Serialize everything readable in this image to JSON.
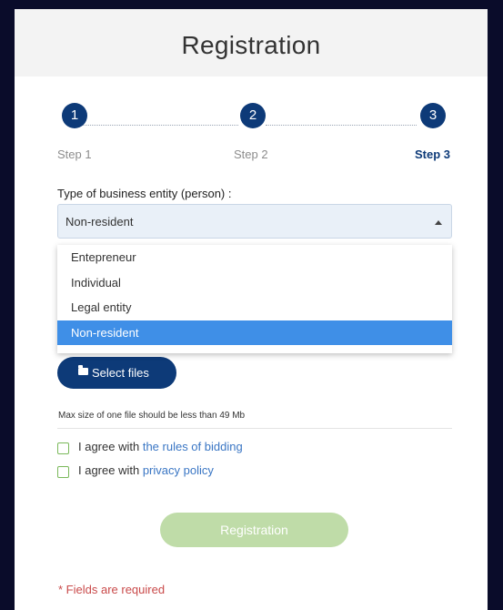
{
  "header": {
    "title": "Registration"
  },
  "steps": [
    {
      "number": "1",
      "label": "Step 1"
    },
    {
      "number": "2",
      "label": "Step 2"
    },
    {
      "number": "3",
      "label": "Step 3"
    }
  ],
  "entity_field": {
    "label": "Type of business entity (person) :",
    "value": "Non-resident",
    "options": [
      "Entepreneur",
      "Individual",
      "Legal entity",
      "Non-resident"
    ]
  },
  "files": {
    "button_label": "Select files",
    "note": "Max size of one file should be less than 49 Mb"
  },
  "agreements": [
    {
      "prefix": "I agree with ",
      "link": "the rules of bidding"
    },
    {
      "prefix": "I agree with ",
      "link": "privacy policy"
    }
  ],
  "submit_label": "Registration",
  "required_note": "*  Fields are required",
  "colors": {
    "primary": "#0d3a78",
    "selected_option": "#3f8fe7",
    "submit_disabled": "#bfdca8",
    "checkbox_border": "#7ab95a",
    "link": "#3a76c4",
    "required": "#c94a4a"
  }
}
